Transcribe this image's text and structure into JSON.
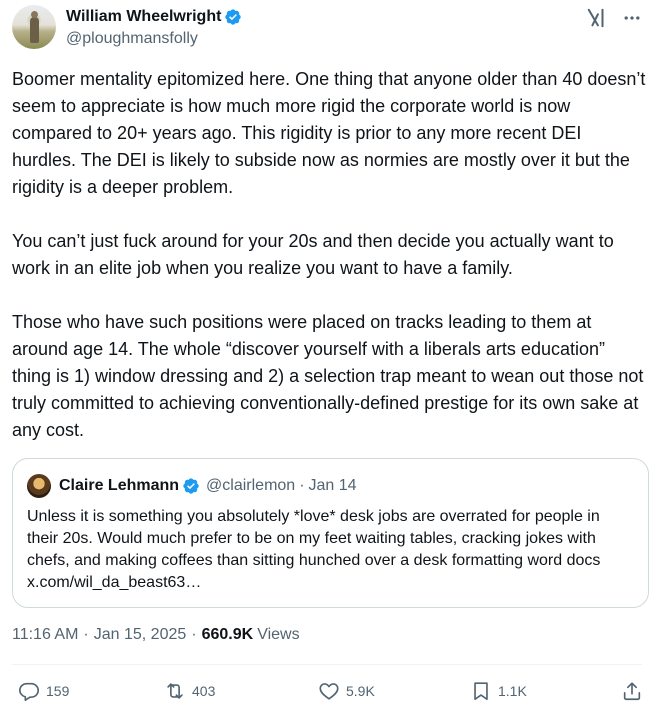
{
  "author": {
    "display_name": "William Wheelwright",
    "handle": "@ploughmansfolly",
    "verified_icon": "verified-badge-icon"
  },
  "tweet": {
    "text": "Boomer mentality epitomized here. One thing that anyone older than 40 doesn’t seem to appreciate is how much more rigid the corporate world is now compared to 20+ years ago. This rigidity is prior to any more recent DEI hurdles. The DEI is likely to subside now as normies are mostly over it but the rigidity is a deeper problem.\n\nYou can’t just fuck around for your 20s and then decide you actually want to work in an elite job when you realize you want to have a family.\n\nThose who have such positions were placed on tracks leading to them at around age 14. The whole “discover yourself with a liberals arts education” thing is 1) window dressing and 2) a selection trap meant to wean out those not truly committed to achieving conventionally-defined prestige for its own sake at any cost.",
    "time": "11:16 AM",
    "date": "Jan 15, 2025",
    "views_count": "660.9K",
    "views_label": "Views"
  },
  "quote": {
    "display_name": "Claire Lehmann",
    "handle": "@clairlemon",
    "date": "Jan 14",
    "text": "Unless it is something you absolutely *love* desk jobs are overrated for people in their 20s. Would much prefer to be on my feet waiting tables, cracking jokes with chefs, and making coffees than sitting hunched over a desk formatting word docs x.com/wil_da_beast63…"
  },
  "actions": {
    "replies": "159",
    "retweets": "403",
    "likes": "5.9K",
    "bookmarks": "1.1K"
  },
  "colors": {
    "verified": "#1d9bf0",
    "text_primary": "#0f1419",
    "text_secondary": "#536471",
    "border": "#cfd9de"
  },
  "separators": {
    "dot": "·"
  }
}
